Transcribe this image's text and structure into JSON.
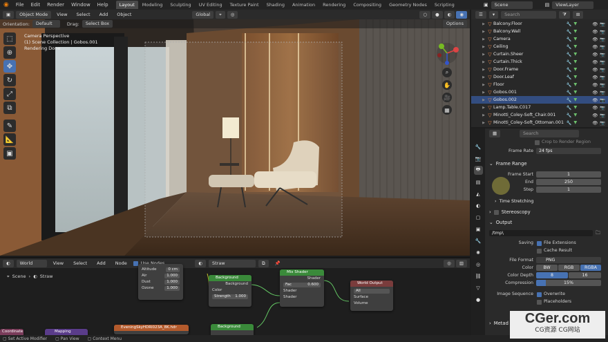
{
  "menu": [
    "File",
    "Edit",
    "Render",
    "Window",
    "Help"
  ],
  "workspaces": [
    "Layout",
    "Modeling",
    "Sculpting",
    "UV Editing",
    "Texture Paint",
    "Shading",
    "Animation",
    "Rendering",
    "Compositing",
    "Geometry Nodes",
    "Scripting"
  ],
  "active_workspace": "Layout",
  "scene_name": "Scene",
  "view_layer": "ViewLayer",
  "viewport": {
    "mode": "Object Mode",
    "menus": [
      "View",
      "Select",
      "Add",
      "Object"
    ],
    "transform": "Global",
    "orientation_label": "Orientation:",
    "orientation_value": "Default",
    "drag_label": "Drag:",
    "drag_value": "Select Box",
    "options": "Options",
    "info_line1": "Camera Perspective",
    "info_line2": "(1) Scene Collection | Gobos.001",
    "info_line3": "Rendering Done"
  },
  "node_editor": {
    "type": "World",
    "menus": [
      "View",
      "Select",
      "Add",
      "Node"
    ],
    "use_nodes": "Use Nodes",
    "world_name": "Straw",
    "breadcrumb_scene": "Scene",
    "breadcrumb_world": "Straw",
    "sky": {
      "altitude_label": "Altitude",
      "altitude_value": "0 cm",
      "air_label": "Air",
      "air_value": "1.000",
      "dust_label": "Dust",
      "dust_value": "1.000",
      "ozone_label": "Ozone",
      "ozone_value": "1.000"
    },
    "bg1": {
      "title": "Background",
      "out": "Background",
      "color": "Color",
      "strength_label": "Strength",
      "strength_value": "1.000"
    },
    "mix": {
      "title": "Mix Shader",
      "out": "Shader",
      "fac_label": "Fac",
      "fac_value": "0.600",
      "in1": "Shader",
      "in2": "Shader"
    },
    "world_out": {
      "title": "World Output",
      "target": "All",
      "surface": "Surface",
      "volume": "Volume"
    },
    "bg2": {
      "title": "Background"
    },
    "bottom_nodes": [
      "Coordinate",
      "Mapping",
      "EveningSkyHDRI023A_8K.hdr"
    ]
  },
  "statusbar": [
    "Set Active Modifier",
    "Pan View",
    "Context Menu"
  ],
  "outliner": {
    "search_placeholder": "Search",
    "items": [
      {
        "name": "Balcony.Floor",
        "selected": false
      },
      {
        "name": "Balcony.Wall",
        "selected": false
      },
      {
        "name": "Camera",
        "selected": false
      },
      {
        "name": "Ceiling",
        "selected": false
      },
      {
        "name": "Curtain.Sheer",
        "selected": false
      },
      {
        "name": "Curtain.Thick",
        "selected": false
      },
      {
        "name": "Door.Frame",
        "selected": false
      },
      {
        "name": "Door.Leaf",
        "selected": false
      },
      {
        "name": "Floor",
        "selected": false
      },
      {
        "name": "Gobos.001",
        "selected": false
      },
      {
        "name": "Gobos.002",
        "selected": true
      },
      {
        "name": "Lamp.Table.C017",
        "selected": false
      },
      {
        "name": "Minotti_Coley-Soft_Chair.001",
        "selected": false
      },
      {
        "name": "Minotti_Coley-Soft_Ottoman.001",
        "selected": false
      }
    ]
  },
  "properties": {
    "search_placeholder": "Search",
    "crop_label": "Crop to Render Region",
    "frame_rate_label": "Frame Rate",
    "frame_rate_value": "24 fps",
    "frame_range_title": "Frame Range",
    "frame_start_label": "Frame Start",
    "frame_start_value": "1",
    "end_label": "End",
    "end_value": "250",
    "step_label": "Step",
    "step_value": "1",
    "time_stretching": "Time Stretching",
    "stereoscopy": "Stereoscopy",
    "output_title": "Output",
    "output_path": "/tmp\\",
    "saving_label": "Saving",
    "file_extensions": "File Extensions",
    "cache_result": "Cache Result",
    "file_format_label": "File Format",
    "file_format_value": "PNG",
    "color_label": "Color",
    "color_options": [
      "BW",
      "RGB",
      "RGBA"
    ],
    "color_active": "RGBA",
    "color_depth_label": "Color Depth",
    "color_depth_options": [
      "8",
      "16"
    ],
    "color_depth_active": "8",
    "compression_label": "Compression",
    "compression_value": "15%",
    "compression_fraction": 0.15,
    "image_sequence_label": "Image Sequence",
    "overwrite": "Overwrite",
    "placeholders": "Placeholders",
    "metadata": "Metad"
  },
  "watermark": {
    "title": "CGer.com",
    "subtitle": "CG资源 CG网站"
  },
  "colors": {
    "accent": "#4772b3",
    "selected_row": "#334d80",
    "node_green": "#3a8a3a",
    "node_red": "#7a3c3c",
    "node_orange": "#b35a2c"
  }
}
